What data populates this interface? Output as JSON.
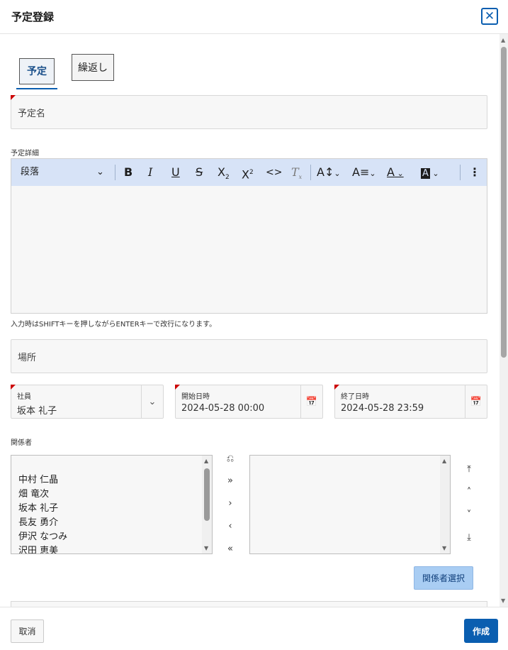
{
  "dialog": {
    "title": "予定登録",
    "close_glyph": "✕"
  },
  "tabs": [
    {
      "label": "予定",
      "active": true
    },
    {
      "label": "繰返し",
      "active": false
    }
  ],
  "fields": {
    "event_name": {
      "placeholder": "予定名"
    },
    "details_label": "予定詳細",
    "paragraph_select": "段落",
    "hint": "入力時はSHIFTキーを押しながらENTERキーで改行になります。",
    "location": {
      "placeholder": "場所"
    },
    "employee": {
      "label": "社員",
      "value": "坂本 礼子"
    },
    "start": {
      "label": "開始日時",
      "value": "2024-05-28 00:00"
    },
    "end": {
      "label": "終了日時",
      "value": "2024-05-28 23:59"
    },
    "participants_label": "関係者"
  },
  "toolbar_icons": [
    "bold-icon",
    "italic-icon",
    "underline-icon",
    "strikethrough-icon",
    "subscript-icon",
    "superscript-icon",
    "code-icon",
    "clear-format-icon",
    "font-size-icon",
    "text-style-icon",
    "text-color-icon",
    "highlight-icon",
    "more-icon"
  ],
  "participants": {
    "available": [
      "中村 仁晶",
      "畑 竜次",
      "坂本 礼子",
      "長友 勇介",
      "伊沢 なつみ",
      "沢田 恵美"
    ],
    "selected": []
  },
  "buttons": {
    "participants_select": "関係者選択",
    "cancel": "取消",
    "create": "作成"
  },
  "colors": {
    "accent": "#0a5eb0",
    "required_marker": "#cc0000",
    "toolbar_bg": "#d7e3f7"
  }
}
